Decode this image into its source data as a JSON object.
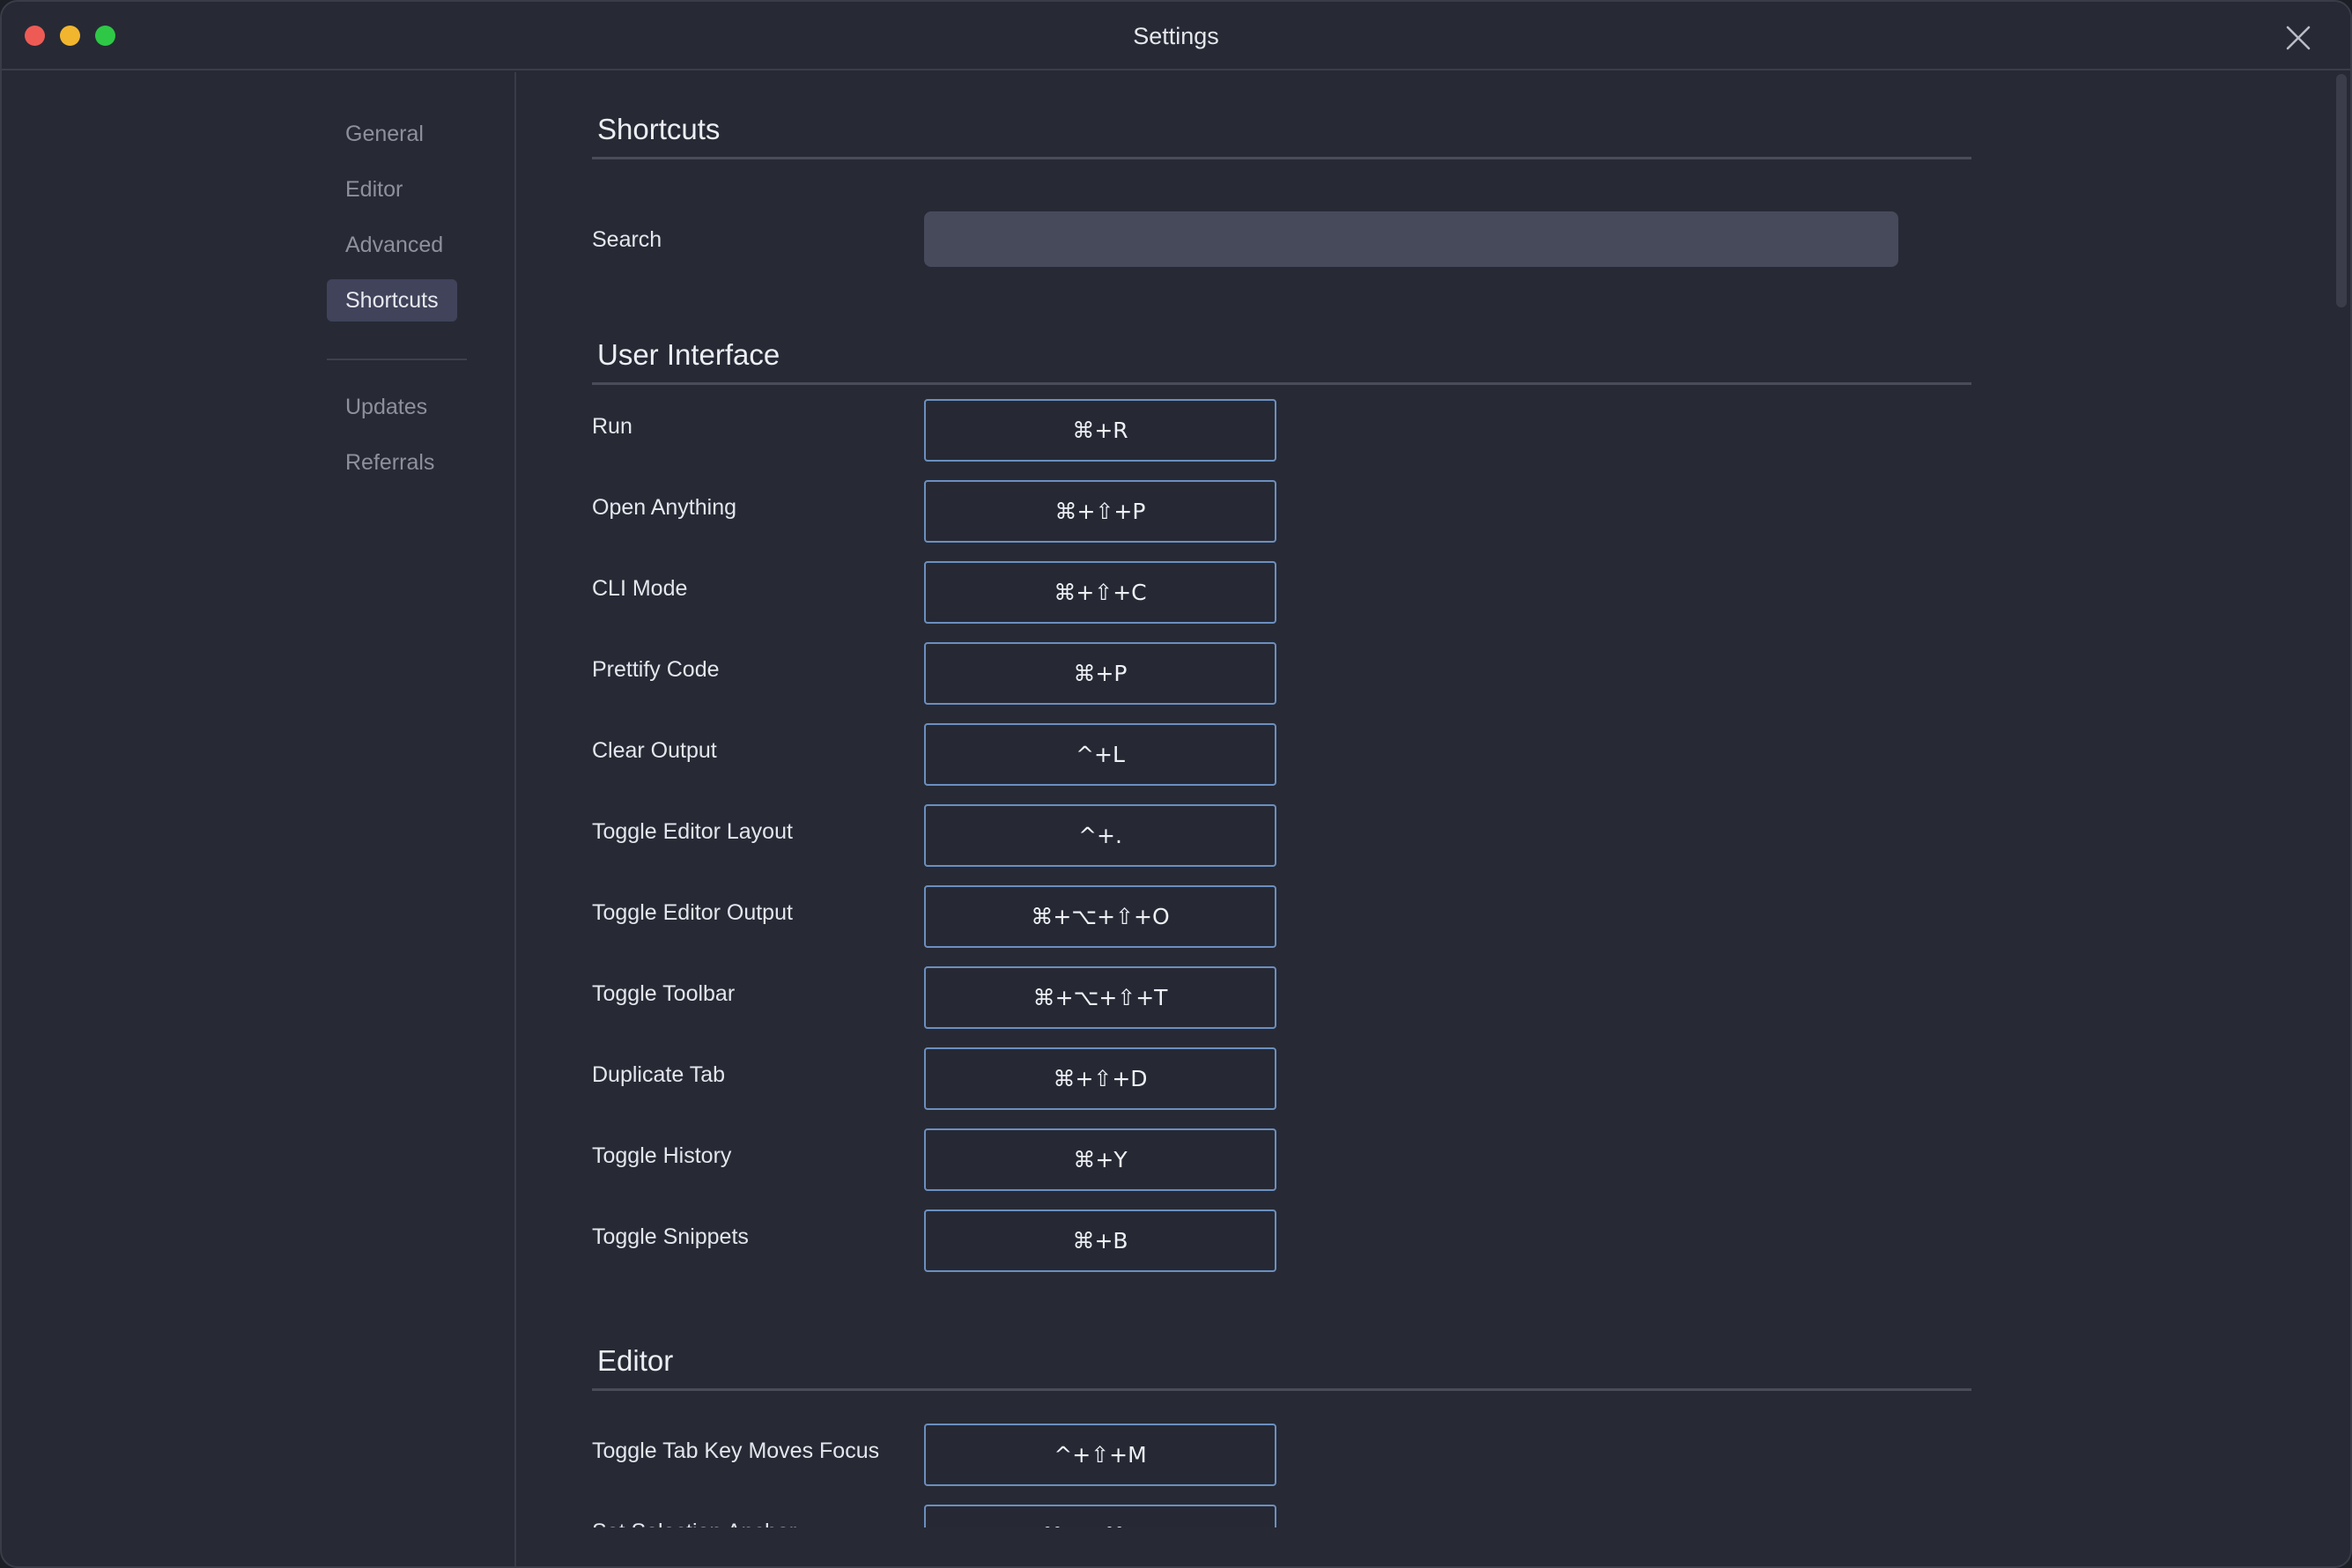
{
  "window": {
    "title": "Settings"
  },
  "sidebar": {
    "items": [
      {
        "label": "General"
      },
      {
        "label": "Editor"
      },
      {
        "label": "Advanced"
      },
      {
        "label": "Shortcuts",
        "active": true
      },
      {
        "label": "Updates"
      },
      {
        "label": "Referrals"
      }
    ]
  },
  "shortcuts": {
    "title": "Shortcuts",
    "search_label": "Search",
    "search_value": ""
  },
  "user_interface": {
    "title": "User Interface",
    "rows": [
      {
        "label": "Run",
        "key": "⌘+R"
      },
      {
        "label": "Open Anything",
        "key": "⌘+⇧+P"
      },
      {
        "label": "CLI Mode",
        "key": "⌘+⇧+C"
      },
      {
        "label": "Prettify Code",
        "key": "⌘+P"
      },
      {
        "label": "Clear Output",
        "key": "^+L"
      },
      {
        "label": "Toggle Editor Layout",
        "key": "^+."
      },
      {
        "label": "Toggle Editor Output",
        "key": "⌘+⌥+⇧+O"
      },
      {
        "label": "Toggle Toolbar",
        "key": "⌘+⌥+⇧+T"
      },
      {
        "label": "Duplicate Tab",
        "key": "⌘+⇧+D"
      },
      {
        "label": "Toggle History",
        "key": "⌘+Y"
      },
      {
        "label": "Toggle Snippets",
        "key": "⌘+B"
      }
    ]
  },
  "editor": {
    "title": "Editor",
    "rows": [
      {
        "label": "Toggle Tab Key Moves Focus",
        "key": "^+⇧+M"
      },
      {
        "label": "Set Selection Anchor",
        "key": "⌘+K ⌘+B"
      }
    ]
  },
  "colors": {
    "background": "#272a35",
    "key_border": "#6b8fc0",
    "active_nav": "#40435a",
    "search_bg": "#474a5b"
  }
}
